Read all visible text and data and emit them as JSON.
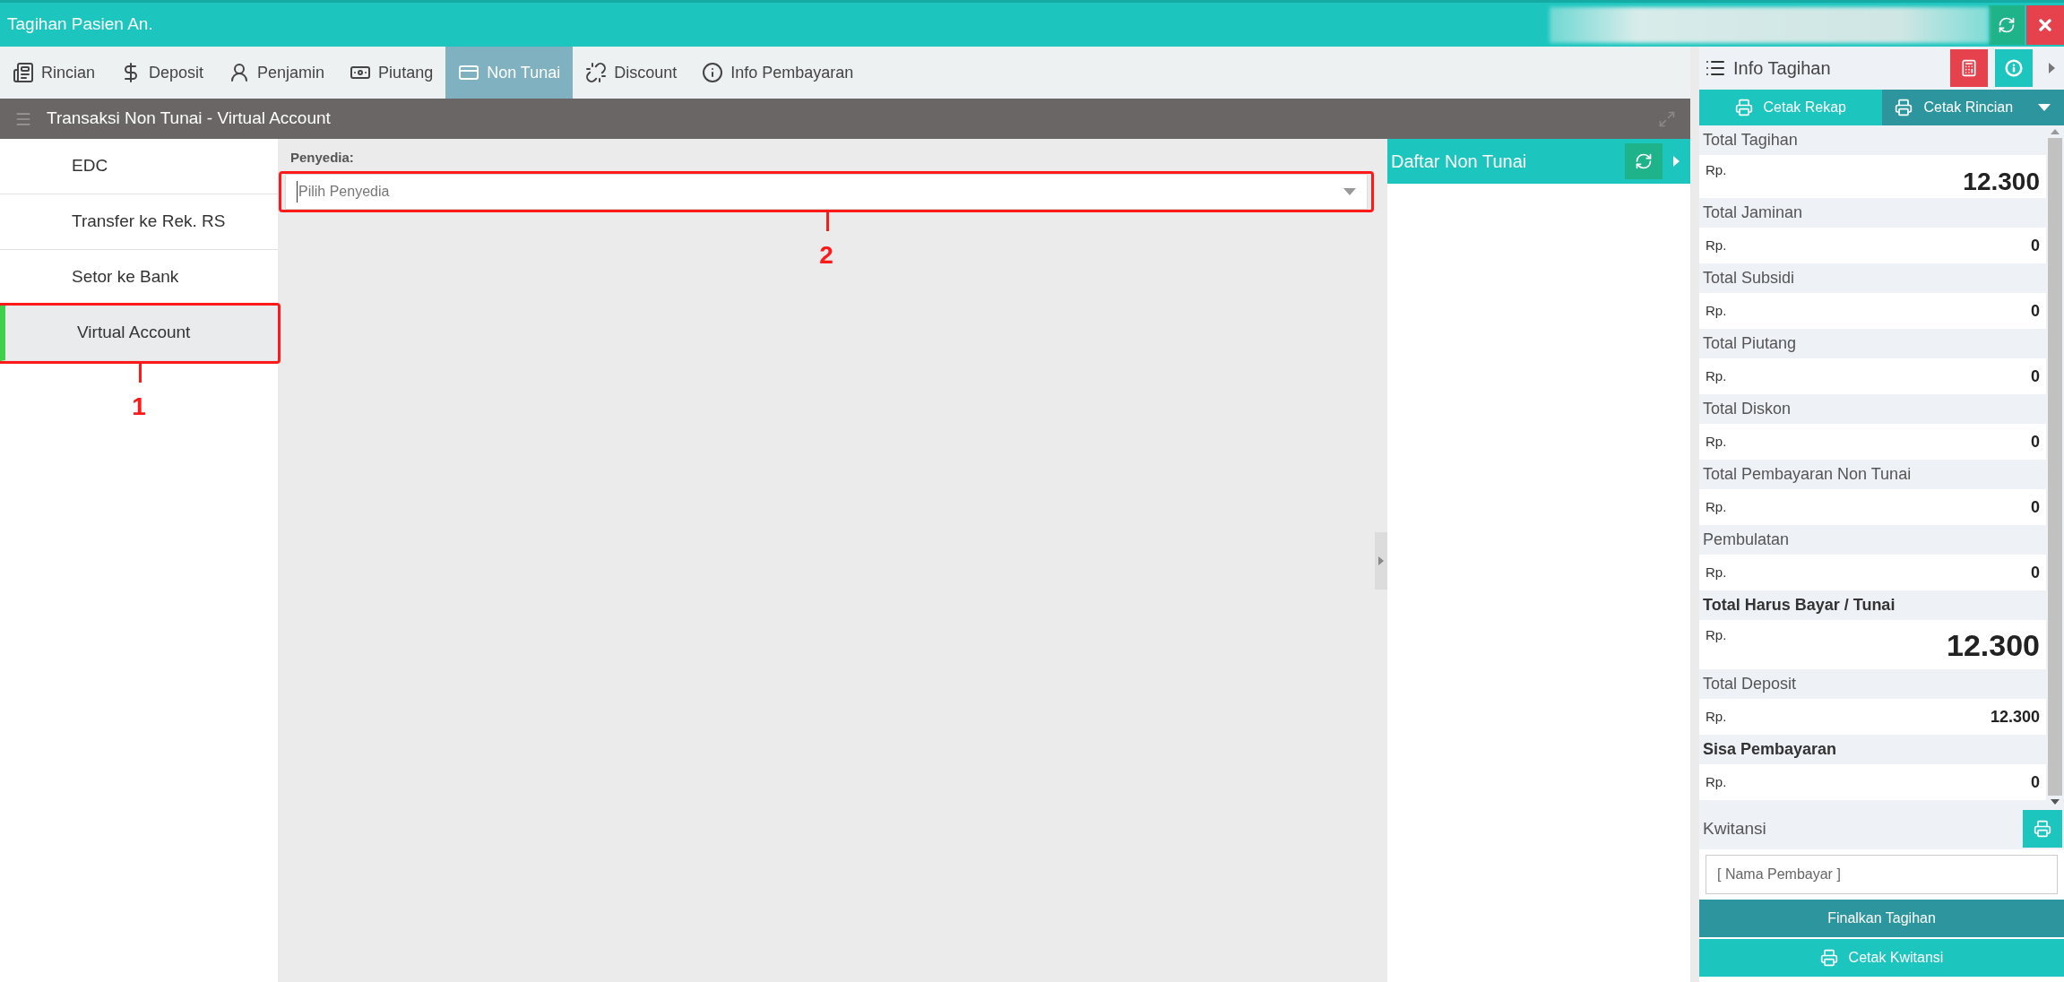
{
  "window": {
    "title": "Tagihan Pasien An."
  },
  "tabs": [
    {
      "label": "Rincian",
      "selected": false
    },
    {
      "label": "Deposit",
      "selected": false
    },
    {
      "label": "Penjamin",
      "selected": false
    },
    {
      "label": "Piutang",
      "selected": false
    },
    {
      "label": "Non Tunai",
      "selected": true
    },
    {
      "label": "Discount",
      "selected": false
    },
    {
      "label": "Info Pembayaran",
      "selected": false
    }
  ],
  "section": {
    "title": "Transaksi Non Tunai - Virtual Account"
  },
  "methods": [
    {
      "label": "EDC",
      "selected": false
    },
    {
      "label": "Transfer ke Rek. RS",
      "selected": false
    },
    {
      "label": "Setor ke Bank",
      "selected": false
    },
    {
      "label": "Virtual Account",
      "selected": true,
      "annotation": "1"
    }
  ],
  "form": {
    "label": "Penyedia:",
    "select": {
      "placeholder": "Pilih Penyedia",
      "annotation": "2"
    }
  },
  "list_panel": {
    "title": "Daftar Non Tunai"
  },
  "info": {
    "title": "Info Tagihan",
    "buttons": [
      {
        "label": "Cetak Rekap"
      },
      {
        "label": "Cetak Rincian"
      }
    ],
    "items": [
      {
        "label": "Total Tagihan",
        "emphasis": false,
        "currency": "Rp.",
        "value": "12.300",
        "kind": "large"
      },
      {
        "label": "Total Jaminan",
        "emphasis": false,
        "currency": "Rp.",
        "value": "0",
        "kind": "normal"
      },
      {
        "label": "Total Subsidi",
        "emphasis": false,
        "currency": "Rp.",
        "value": "0",
        "kind": "normal"
      },
      {
        "label": "Total Piutang",
        "emphasis": false,
        "currency": "Rp.",
        "value": "0",
        "kind": "normal"
      },
      {
        "label": "Total Diskon",
        "emphasis": false,
        "currency": "Rp.",
        "value": "0",
        "kind": "normal"
      },
      {
        "label": "Total Pembayaran Non Tunai",
        "emphasis": false,
        "currency": "Rp.",
        "value": "0",
        "kind": "normal"
      },
      {
        "label": "Pembulatan",
        "emphasis": false,
        "currency": "Rp.",
        "value": "0",
        "kind": "normal"
      },
      {
        "label": "Total Harus Bayar / Tunai",
        "emphasis": true,
        "currency": "Rp.",
        "value": "12.300",
        "kind": "xlarge"
      },
      {
        "label": "Total Deposit",
        "emphasis": false,
        "currency": "Rp.",
        "value": "12.300",
        "kind": "normal"
      },
      {
        "label": "Sisa Pembayaran",
        "emphasis": true,
        "currency": "Rp.",
        "value": "0",
        "kind": "normal"
      }
    ],
    "receipt": {
      "label": "Kwitansi",
      "payer": {
        "placeholder": "[ Nama Pembayar ]"
      }
    },
    "actions": [
      {
        "label": "Finalkan Tagihan",
        "kind": "primary"
      },
      {
        "label": "Cetak Kwitansi",
        "kind": "print"
      }
    ]
  }
}
